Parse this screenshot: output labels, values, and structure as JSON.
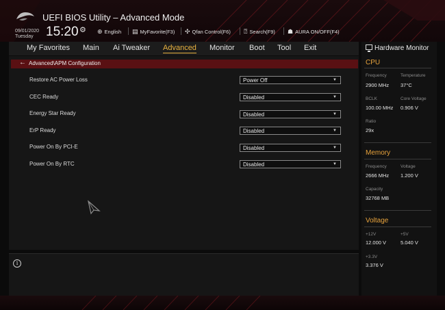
{
  "header": {
    "title": "UEFI BIOS Utility – Advanced Mode",
    "date": "09/01/2020",
    "day": "Tuesday",
    "time": "15:20",
    "toolbar": [
      {
        "icon": "globe-icon",
        "label": "English"
      },
      {
        "icon": "myfavorite-icon",
        "label": "MyFavorite(F3)"
      },
      {
        "icon": "fan-icon",
        "label": "Qfan Control(F6)"
      },
      {
        "icon": "help-search-icon",
        "label": "Search(F9)"
      },
      {
        "icon": "aura-icon",
        "label": "AURA ON/OFF(F4)"
      }
    ]
  },
  "menu": {
    "items": [
      "My Favorites",
      "Main",
      "Ai Tweaker",
      "Advanced",
      "Monitor",
      "Boot",
      "Tool",
      "Exit"
    ],
    "active": "Advanced"
  },
  "breadcrumb": "Advanced\\APM Configuration",
  "settings": [
    {
      "label": "Restore AC Power Loss",
      "value": "Power Off"
    },
    {
      "label": "CEC Ready",
      "value": "Disabled"
    },
    {
      "label": "Energy Star Ready",
      "value": "Disabled"
    },
    {
      "label": "ErP Ready",
      "value": "Disabled"
    },
    {
      "label": "Power On By PCI-E",
      "value": "Disabled"
    },
    {
      "label": "Power On By RTC",
      "value": "Disabled"
    }
  ],
  "hardware_monitor": {
    "title": "Hardware Monitor",
    "cpu": {
      "title": "CPU",
      "frequency_label": "Frequency",
      "frequency": "2900 MHz",
      "temperature_label": "Temperature",
      "temperature": "37°C",
      "bclk_label": "BCLK",
      "bclk": "100.00 MHz",
      "core_voltage_label": "Core Voltage",
      "core_voltage": "0.906 V",
      "ratio_label": "Ratio",
      "ratio": "29x"
    },
    "memory": {
      "title": "Memory",
      "frequency_label": "Frequency",
      "frequency": "2666 MHz",
      "voltage_label": "Voltage",
      "voltage": "1.200 V",
      "capacity_label": "Capacity",
      "capacity": "32768 MB"
    },
    "voltage": {
      "title": "Voltage",
      "v12_label": "+12V",
      "v12": "12.000 V",
      "v5_label": "+5V",
      "v5": "5.040 V",
      "v33_label": "+3.3V",
      "v33": "3.376 V"
    }
  },
  "colors": {
    "accent": "#e8b240",
    "section": "#e8a33c",
    "breadcrumb_bg": "#5a1013"
  }
}
